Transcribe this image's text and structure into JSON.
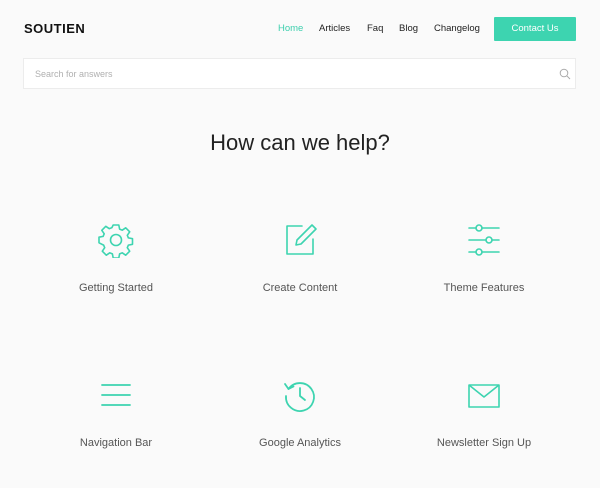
{
  "brand": {
    "logo": "SOUTIEN",
    "accent": "#3dd4b0"
  },
  "nav": {
    "items": [
      {
        "label": "Home",
        "active": true
      },
      {
        "label": "Articles",
        "active": false
      },
      {
        "label": "Faq",
        "active": false
      },
      {
        "label": "Blog",
        "active": false
      },
      {
        "label": "Changelog",
        "active": false
      }
    ],
    "contact_label": "Contact Us"
  },
  "search": {
    "placeholder": "Search for answers",
    "value": "",
    "icon": "search-icon"
  },
  "hero": {
    "title": "How can we help?"
  },
  "categories": [
    {
      "label": "Getting Started",
      "icon": "gear-icon"
    },
    {
      "label": "Create Content",
      "icon": "edit-icon"
    },
    {
      "label": "Theme Features",
      "icon": "sliders-icon"
    },
    {
      "label": "Navigation Bar",
      "icon": "menu-icon"
    },
    {
      "label": "Google Analytics",
      "icon": "history-icon"
    },
    {
      "label": "Newsletter Sign Up",
      "icon": "envelope-icon"
    }
  ]
}
